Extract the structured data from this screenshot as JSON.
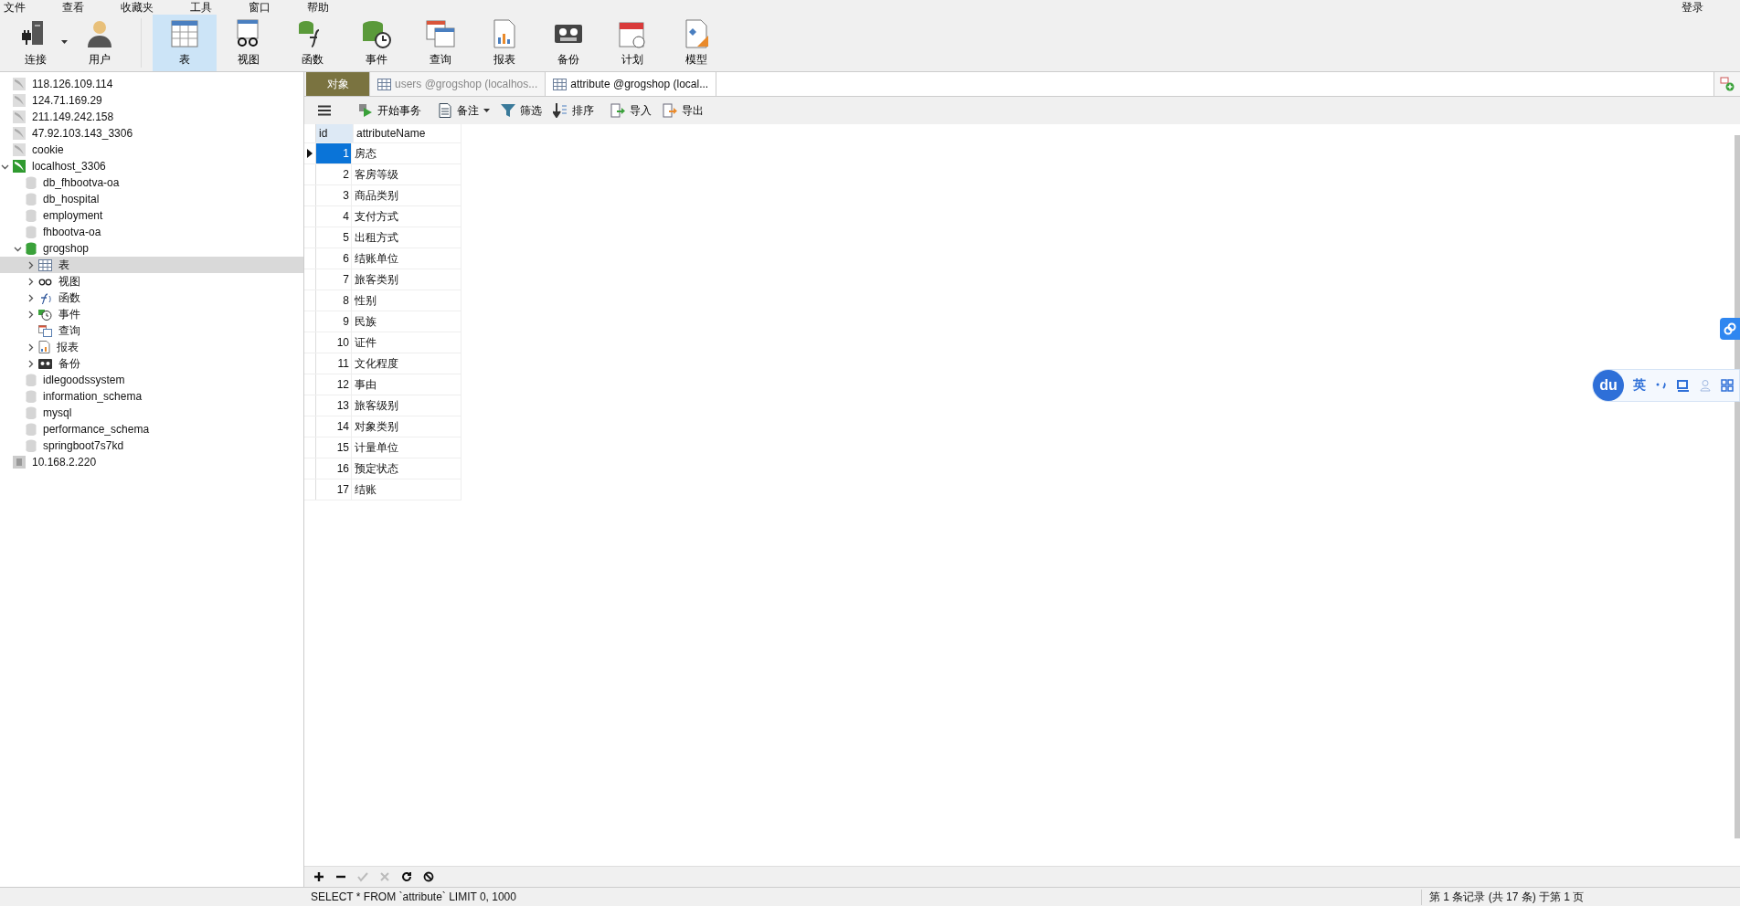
{
  "menu_bar": [
    "文件",
    "查看",
    "收藏夹",
    "工具",
    "窗口",
    "帮助"
  ],
  "login": "登录",
  "toolbar": {
    "left": [
      {
        "label": "连接",
        "kind": "connection",
        "dropdown": true,
        "selected": false
      },
      {
        "label": "用户",
        "kind": "user",
        "dropdown": false,
        "selected": false
      }
    ],
    "main": [
      {
        "label": "表",
        "kind": "table",
        "selected": true
      },
      {
        "label": "视图",
        "kind": "view",
        "selected": false
      },
      {
        "label": "函数",
        "kind": "function",
        "selected": false
      },
      {
        "label": "事件",
        "kind": "event",
        "selected": false
      },
      {
        "label": "查询",
        "kind": "query",
        "selected": false
      },
      {
        "label": "报表",
        "kind": "report",
        "selected": false
      },
      {
        "label": "备份",
        "kind": "backup",
        "selected": false
      },
      {
        "label": "计划",
        "kind": "schedule",
        "selected": false
      },
      {
        "label": "模型",
        "kind": "model",
        "selected": false
      }
    ]
  },
  "tree": [
    {
      "label": "118.126.109.114",
      "kind": "connection",
      "connected": false,
      "selected": false
    },
    {
      "label": "124.71.169.29",
      "kind": "connection",
      "connected": false,
      "selected": false
    },
    {
      "label": "211.149.242.158",
      "kind": "connection",
      "connected": false,
      "selected": false
    },
    {
      "label": "47.92.103.143_3306",
      "kind": "connection",
      "connected": false,
      "selected": false
    },
    {
      "label": "cookie",
      "kind": "connection",
      "connected": false,
      "selected": false
    },
    {
      "label": "localhost_3306",
      "kind": "connection",
      "connected": true,
      "expanded": true,
      "selected": false,
      "children": [
        {
          "label": "db_fhbootva-oa",
          "kind": "database",
          "connected": false,
          "selected": false
        },
        {
          "label": "db_hospital",
          "kind": "database",
          "connected": false,
          "selected": false
        },
        {
          "label": "employment",
          "kind": "database",
          "connected": false,
          "selected": false
        },
        {
          "label": "fhbootva-oa",
          "kind": "database",
          "connected": false,
          "selected": false
        },
        {
          "label": "grogshop",
          "kind": "database",
          "connected": true,
          "expanded": true,
          "selected": false,
          "children": [
            {
              "label": "表",
              "kind": "table",
              "expanded": false,
              "selected": true
            },
            {
              "label": "视图",
              "kind": "view",
              "expanded": false,
              "selected": false
            },
            {
              "label": "函数",
              "kind": "function",
              "expanded": false,
              "selected": false
            },
            {
              "label": "事件",
              "kind": "event",
              "expanded": false,
              "selected": false
            },
            {
              "label": "查询",
              "kind": "query",
              "selected": false
            },
            {
              "label": "报表",
              "kind": "report",
              "expanded": false,
              "selected": false
            },
            {
              "label": "备份",
              "kind": "backup",
              "expanded": false,
              "selected": false
            }
          ]
        },
        {
          "label": "idlegoodssystem",
          "kind": "database",
          "connected": false,
          "selected": false
        },
        {
          "label": "information_schema",
          "kind": "database",
          "connected": false,
          "selected": false
        },
        {
          "label": "mysql",
          "kind": "database",
          "connected": false,
          "selected": false
        },
        {
          "label": "performance_schema",
          "kind": "database",
          "connected": false,
          "selected": false
        },
        {
          "label": "springboot7s7kd",
          "kind": "database",
          "connected": false,
          "selected": false
        }
      ]
    },
    {
      "label": "10.168.2.220",
      "kind": "remote",
      "connected": false,
      "selected": false
    }
  ],
  "tabs": [
    {
      "label": "对象",
      "kind": "objects",
      "selected": false
    },
    {
      "label": "users @grogshop (localhos...",
      "kind": "table",
      "selected": false
    },
    {
      "label": "attribute @grogshop (local...",
      "kind": "table",
      "selected": true
    }
  ],
  "data_toolbar": [
    {
      "label": "开始事务",
      "kind": "transaction",
      "dropdown": false
    },
    {
      "label": "备注",
      "kind": "memo",
      "dropdown": true
    },
    {
      "label": "筛选",
      "kind": "filter",
      "dropdown": false
    },
    {
      "label": "排序",
      "kind": "sort",
      "dropdown": false
    },
    {
      "label": "导入",
      "kind": "import",
      "dropdown": false
    },
    {
      "label": "导出",
      "kind": "export",
      "dropdown": false
    }
  ],
  "table": {
    "columns": [
      "id",
      "attributeName"
    ],
    "rows": [
      {
        "id": "1",
        "name": "房态",
        "selected": true
      },
      {
        "id": "2",
        "name": "客房等级",
        "selected": false
      },
      {
        "id": "3",
        "name": "商品类别",
        "selected": false
      },
      {
        "id": "4",
        "name": "支付方式",
        "selected": false
      },
      {
        "id": "5",
        "name": "出租方式",
        "selected": false
      },
      {
        "id": "6",
        "name": "结账单位",
        "selected": false
      },
      {
        "id": "7",
        "name": "旅客类别",
        "selected": false
      },
      {
        "id": "8",
        "name": "性别",
        "selected": false
      },
      {
        "id": "9",
        "name": "民族",
        "selected": false
      },
      {
        "id": "10",
        "name": "证件",
        "selected": false
      },
      {
        "id": "11",
        "name": "文化程度",
        "selected": false
      },
      {
        "id": "12",
        "name": "事由",
        "selected": false
      },
      {
        "id": "13",
        "name": "旅客级别",
        "selected": false
      },
      {
        "id": "14",
        "name": "对象类别",
        "selected": false
      },
      {
        "id": "15",
        "name": "计量单位",
        "selected": false
      },
      {
        "id": "16",
        "name": "预定状态",
        "selected": false
      },
      {
        "id": "17",
        "name": "结账",
        "selected": false
      }
    ]
  },
  "record_buttons": [
    {
      "kind": "add",
      "disabled": false
    },
    {
      "kind": "delete",
      "disabled": false
    },
    {
      "kind": "apply",
      "disabled": true
    },
    {
      "kind": "discard",
      "disabled": true
    },
    {
      "kind": "refresh",
      "disabled": false
    },
    {
      "kind": "stop",
      "disabled": false
    }
  ],
  "status_bar": {
    "query": "SELECT * FROM `attribute` LIMIT 0, 1000",
    "records": "第 1 条记录 (共 17 条) 于第 1 页"
  },
  "ime_toolbar": {
    "logo": "du",
    "mode": "英"
  }
}
